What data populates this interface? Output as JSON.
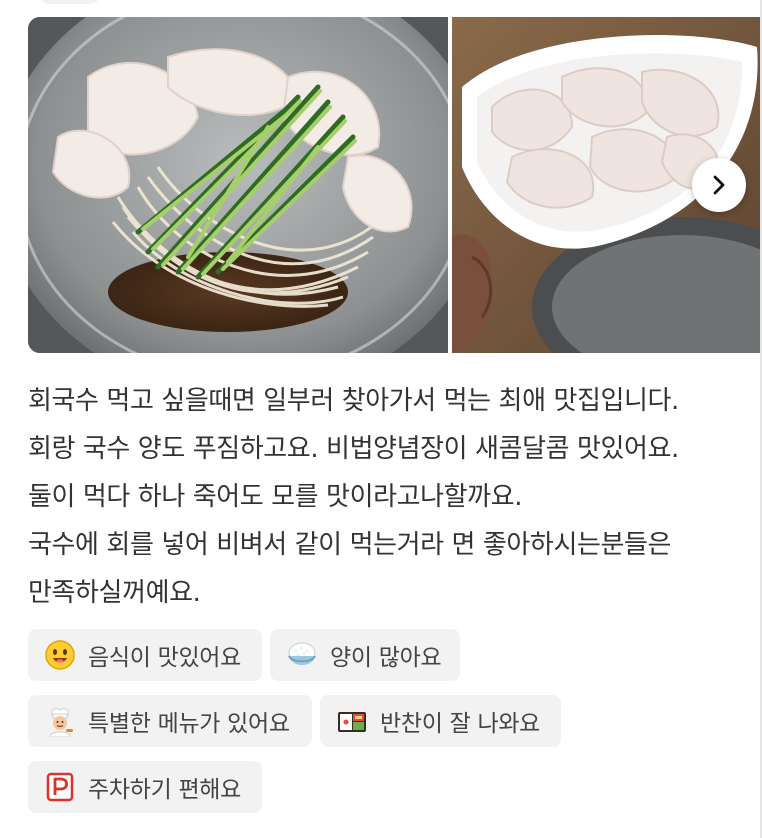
{
  "gallery": {
    "photos": [
      {
        "alt": "",
        "icon": "noodle-bowl-photo"
      },
      {
        "alt": "",
        "icon": "sliced-raw-fish-plate-photo"
      }
    ],
    "next_icon": "chevron-right-icon"
  },
  "review": {
    "lines": [
      "회국수 먹고 싶을때면 일부러 찾아가서 먹는 최애 맛집입니다.",
      "회랑 국수 양도 푸짐하고요. 비법양념장이 새콤달콤 맛있어요.",
      "둘이 먹다 하나 죽어도 모를 맛이라고나할까요.",
      "국수에 회를 넣어 비벼서 같이 먹는거라 면 좋아하시는분들은",
      "만족하실꺼예요."
    ]
  },
  "keywords": [
    {
      "label": "음식이 맛있어요",
      "icon": "smiling-face-icon"
    },
    {
      "label": "양이 많아요",
      "icon": "rice-bowl-icon"
    },
    {
      "label": "특별한 메뉴가 있어요",
      "icon": "chef-icon"
    },
    {
      "label": "반찬이 잘 나와요",
      "icon": "bento-box-icon"
    },
    {
      "label": "주차하기 편해요",
      "icon": "parking-sign-icon"
    }
  ],
  "colors": {
    "text": "#333333",
    "chip_background": "#f2f2f2",
    "chip_text": "#444444",
    "parking_icon": "#d9342b"
  }
}
